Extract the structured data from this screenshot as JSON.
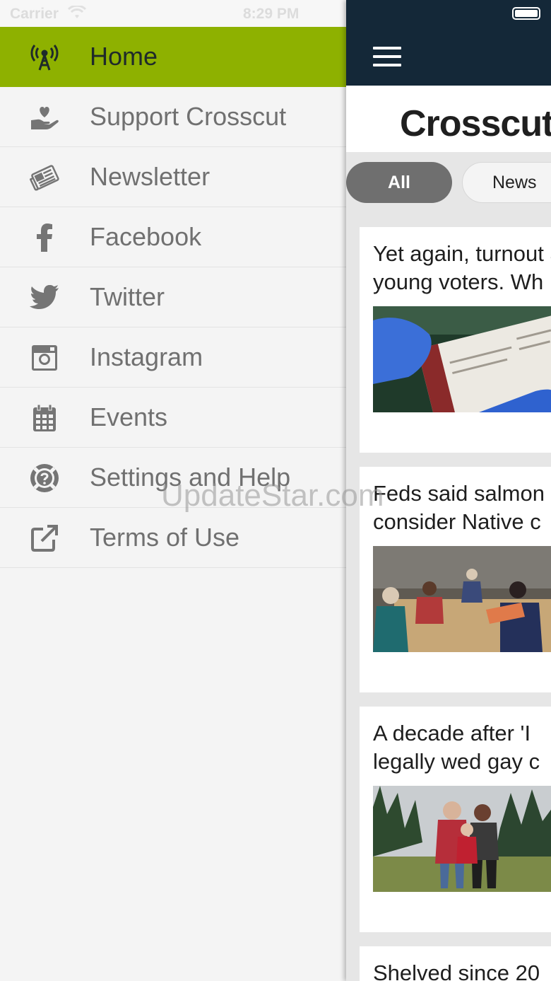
{
  "status_bar": {
    "carrier": "Carrier",
    "time": "8:29 PM"
  },
  "menu": {
    "items": [
      {
        "label": "Home",
        "icon": "radio-tower-icon"
      },
      {
        "label": "Support Crosscut",
        "icon": "heart-hand-icon"
      },
      {
        "label": "Newsletter",
        "icon": "newspaper-icon"
      },
      {
        "label": "Facebook",
        "icon": "facebook-icon"
      },
      {
        "label": "Twitter",
        "icon": "twitter-icon"
      },
      {
        "label": "Instagram",
        "icon": "instagram-icon"
      },
      {
        "label": "Events",
        "icon": "calendar-icon"
      },
      {
        "label": "Settings and Help",
        "icon": "help-icon"
      },
      {
        "label": "Terms of Use",
        "icon": "external-link-icon"
      }
    ],
    "active_index": 0
  },
  "header": {
    "logo": "Crosscut"
  },
  "tabs": {
    "all": "All",
    "news": "News"
  },
  "articles": [
    {
      "title_line1": "Yet again, turnout among",
      "title_line2": "young voters. Wh"
    },
    {
      "title_line1": "Feds said salmon",
      "title_line2": "consider Native c"
    },
    {
      "title_line1": "A decade after 'I",
      "title_line2": "legally wed gay c"
    },
    {
      "title_line1": "Shelved since 20"
    }
  ],
  "watermark": "UpdateStar.com",
  "colors": {
    "accent": "#8eb100",
    "navbar": "#142838",
    "tab_active": "#6f6f6f"
  }
}
